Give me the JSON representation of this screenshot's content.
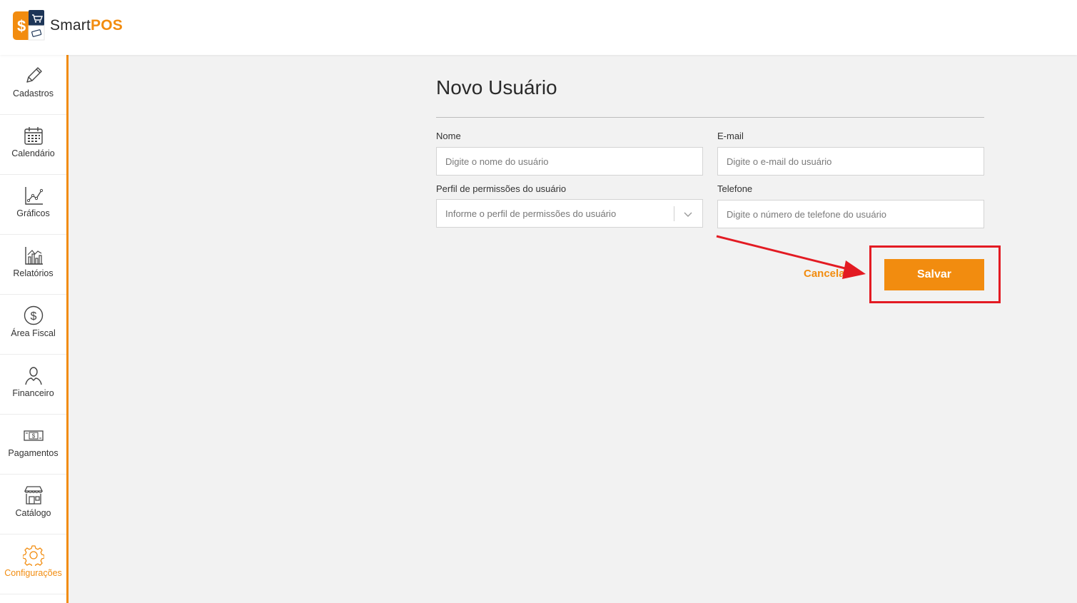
{
  "app": {
    "logo_text_regular": "Smart",
    "logo_text_bold": "POS",
    "brand_color": "#f28c0f"
  },
  "sidebar": {
    "items": [
      {
        "label": "Cadastros",
        "icon": "pencil-icon",
        "active": false
      },
      {
        "label": "Calendário",
        "icon": "calendar-icon",
        "active": false
      },
      {
        "label": "Gráficos",
        "icon": "line-chart-icon",
        "active": false
      },
      {
        "label": "Relatórios",
        "icon": "bar-chart-icon",
        "active": false
      },
      {
        "label": "Área Fiscal",
        "icon": "dollar-circle-icon",
        "active": false
      },
      {
        "label": "Financeiro",
        "icon": "person-icon",
        "active": false
      },
      {
        "label": "Pagamentos",
        "icon": "banknote-icon",
        "active": false
      },
      {
        "label": "Catálogo",
        "icon": "storefront-icon",
        "active": false
      },
      {
        "label": "Configurações",
        "icon": "gear-icon",
        "active": true
      }
    ]
  },
  "form": {
    "title": "Novo Usuário",
    "fields": {
      "name": {
        "label": "Nome",
        "placeholder": "Digite o nome do usuário",
        "value": ""
      },
      "email": {
        "label": "E-mail",
        "placeholder": "Digite o e-mail do usuário",
        "value": ""
      },
      "profile": {
        "label": "Perfil de permissões do usuário",
        "placeholder": "Informe o perfil de permissões do usuário",
        "value": ""
      },
      "phone": {
        "label": "Telefone",
        "placeholder": "Digite o número de telefone do usuário",
        "value": ""
      }
    },
    "cancel_label": "Cancelar",
    "save_label": "Salvar"
  },
  "annotation": {
    "color": "#e31b23"
  }
}
